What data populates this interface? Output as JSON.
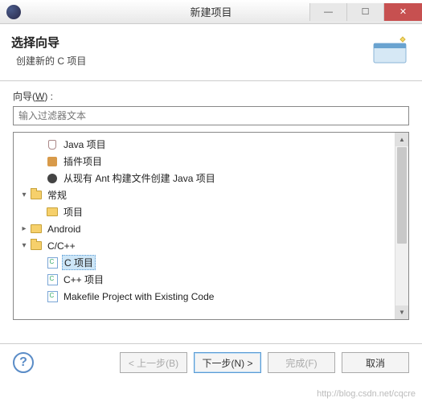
{
  "window": {
    "title": "新建项目",
    "minimize_tip": "最小化",
    "maximize_tip": "最大化",
    "close_tip": "关闭"
  },
  "header": {
    "title": "选择向导",
    "subtitle": "创建新的 C 项目"
  },
  "wizard": {
    "label_prefix": "向导(",
    "label_mnemonic": "W",
    "label_suffix": ") :",
    "filter_placeholder": "输入过滤器文本"
  },
  "tree": [
    {
      "depth": 1,
      "expander": "",
      "icon": "java-icon",
      "label": "Java 项目"
    },
    {
      "depth": 1,
      "expander": "",
      "icon": "plugin-icon",
      "label": "插件项目"
    },
    {
      "depth": 1,
      "expander": "",
      "icon": "ant-icon",
      "label": "从现有 Ant 构建文件创建 Java 项目"
    },
    {
      "depth": 0,
      "expander": "▾",
      "icon": "folder-open-icon",
      "label": "常规"
    },
    {
      "depth": 1,
      "expander": "",
      "icon": "folder-icon",
      "label": "项目"
    },
    {
      "depth": 0,
      "expander": "▸",
      "icon": "folder-icon",
      "label": "Android"
    },
    {
      "depth": 0,
      "expander": "▾",
      "icon": "folder-open-icon",
      "label": "C/C++"
    },
    {
      "depth": 1,
      "expander": "",
      "icon": "c-file-icon",
      "label": "C 项目",
      "selected": true
    },
    {
      "depth": 1,
      "expander": "",
      "icon": "c-file-icon",
      "label": "C++ 项目"
    },
    {
      "depth": 1,
      "expander": "",
      "icon": "c-file-icon",
      "label": "Makefile Project with Existing Code"
    }
  ],
  "buttons": {
    "back": "< 上一步(B)",
    "next": "下一步(N) >",
    "finish": "完成(F)",
    "cancel": "取消"
  },
  "help_tip": "帮助",
  "watermark": "http://blog.csdn.net/cqcre"
}
